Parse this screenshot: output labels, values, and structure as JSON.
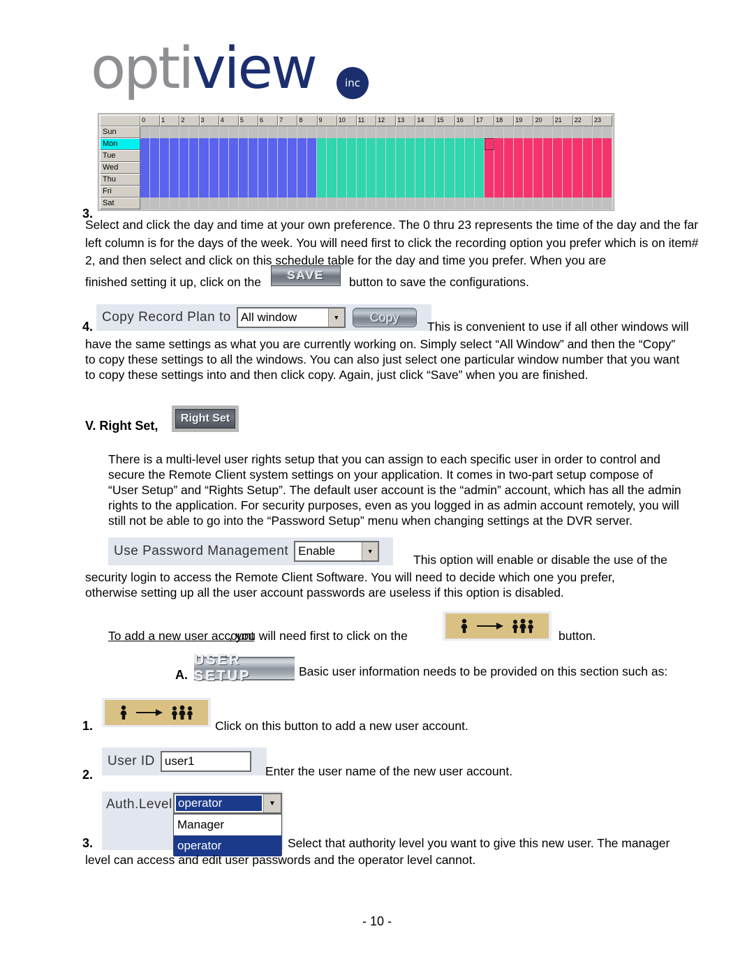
{
  "brand": {
    "name_part1": "opti",
    "name_part2": "view",
    "suffix": "inc"
  },
  "schedule": {
    "days": [
      "Sun",
      "Mon",
      "Tue",
      "Wed",
      "Thu",
      "Fri",
      "Sat"
    ],
    "selected_day": "Mon",
    "hours": [
      "0",
      "1",
      "2",
      "3",
      "4",
      "5",
      "6",
      "7",
      "8",
      "9",
      "10",
      "11",
      "12",
      "13",
      "14",
      "15",
      "16",
      "17",
      "18",
      "19",
      "20",
      "21",
      "22",
      "23"
    ],
    "colors": {
      "blue": "#5a62f0",
      "green": "#2fd6ae",
      "pink": "#f7336e",
      "empty": "#c0c0c0",
      "selected_day_highlight": "#00f0f0"
    },
    "row_fill": {
      "Sun": "empty",
      "Mon": "recording",
      "Tue": "recording",
      "Wed": "recording",
      "Thu": "recording",
      "Fri": "recording",
      "Sat": "empty"
    },
    "segments": [
      {
        "color": "blue",
        "from_col": 0,
        "to_col": 17
      },
      {
        "color": "green",
        "from_col": 18,
        "to_col": 34
      },
      {
        "color": "pink",
        "from_col": 35,
        "to_col": 47
      }
    ],
    "cursor_cell": {
      "day": "Mon",
      "col": 35
    }
  },
  "step3": {
    "number": "3.",
    "body": "Select and click the day and time at your own preference. The 0 thru 23 represents the time of the day and the far left column is for the days of the week.  You will need first to click the recording option you prefer which is on item# 2, and then select and click on this schedule table for the day and time you prefer. When you are",
    "line_before_button": "finished setting it up, click on the",
    "save_button_label": "SAVE",
    "line_after_button": "button to save the configurations."
  },
  "step4": {
    "number": "4.",
    "copy_label": "Copy Record Plan to",
    "dropdown_value": "All window",
    "copy_button_label": "Copy",
    "body": "This is convenient to use if all other windows will have the same settings as what you are currently working on. Simply select “All Window” and then the “Copy” to copy these settings to all the windows. You can also just select one particular window number that you want to copy these settings into and then click copy. Again, just click “Save” when you are finished.",
    "body_line1": "This is convenient to use if all other windows will",
    "body_line2": "have the same settings as what you are currently working on. Simply select “All Window” and then the “Copy”",
    "body_line3": "to copy these settings to all the windows. You can also just select one particular window number that you want",
    "body_line4": "to copy these settings into and then click copy. Again, just click “Save” when you are finished."
  },
  "section5": {
    "heading": "V.  Right Set,",
    "button_label": "Right Set",
    "paragraph": "There is a multi-level user rights setup that you can assign to each specific user in order to control and secure the Remote Client system settings on your application. It comes in two-part setup compose of “User Setup” and “Rights Setup”. The default user account is the “admin” account, which has all the admin rights to the application. For security purposes, even as you logged in as admin account remotely, you will still not be able to go into the “Password Setup” menu when changing settings at the DVR server.",
    "p_line1": "There is a multi-level user rights setup that you can assign to each specific user in order to control and",
    "p_line2": "secure the Remote Client system settings on your application. It comes in two-part setup compose of",
    "p_line3": "“User Setup” and “Rights Setup”. The default user account is the “admin” account, which has all the admin",
    "p_line4": "rights to the application. For security purposes, even as you logged in as admin account remotely, you will",
    "p_line5": "still not be able to go into the “Password Setup” menu when changing settings at the DVR server."
  },
  "password_management": {
    "label": "Use Password Management",
    "value": "Enable",
    "body_line1": "This option will enable or disable the use of the",
    "body_line2": "security login to access the Remote Client Software. You will need to decide which one you prefer,",
    "body_line3": "otherwise setting up all the user account passwords are useless if this option is disabled."
  },
  "add_user": {
    "text_before": "To add a new user account",
    "text_middle": ", you will need first to click on the",
    "text_after": "button.",
    "icon_single": "person-icon",
    "icon_arrow": "arrow-right-icon",
    "icon_group": "people-group-icon"
  },
  "user_setup": {
    "letter": "A.",
    "banner_label": "USER  SETUP",
    "description": "Basic user information needs to be provided on this section such as:",
    "items": [
      {
        "number": "1.",
        "text": "Click on this button to add a new user account."
      },
      {
        "number": "2.",
        "label": "User ID",
        "value": "user1",
        "text": "Enter the user name of the new user account."
      },
      {
        "number": "3.",
        "label": "Auth.Level",
        "value": "operator",
        "options": [
          "Manager",
          "operator"
        ],
        "text_line1": "Select that authority level you want to give this new user. The manager",
        "text_line2": "level can access and edit user passwords and the operator level cannot."
      }
    ]
  },
  "footer": {
    "page_number": "- 10 -"
  }
}
